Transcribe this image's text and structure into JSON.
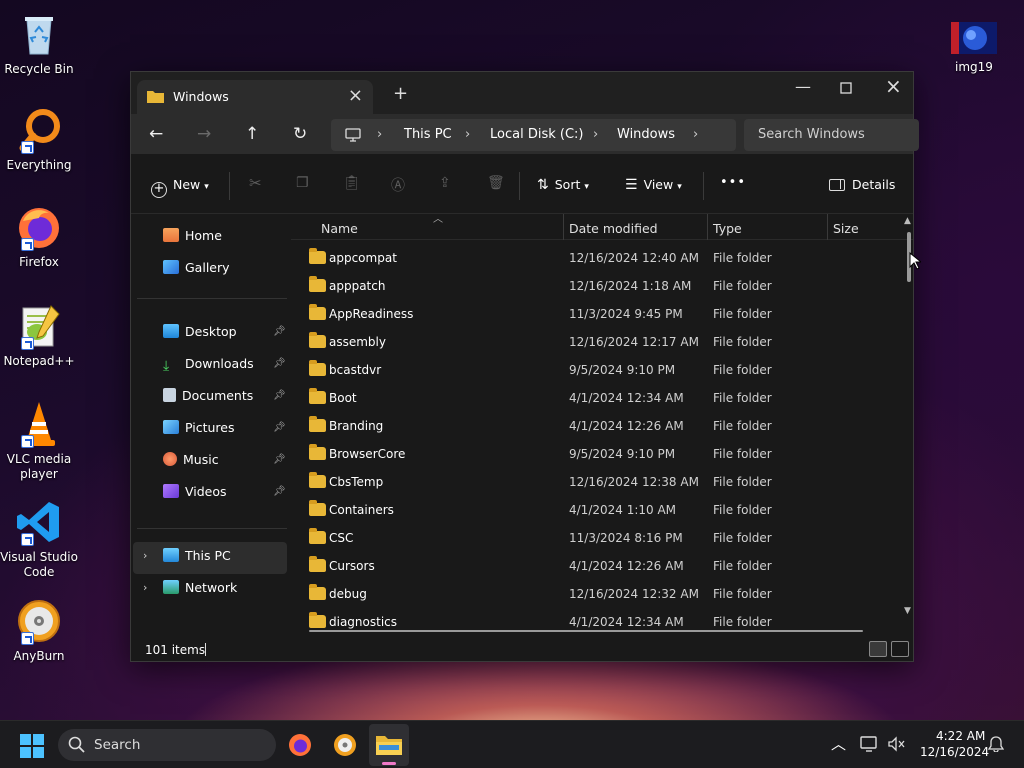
{
  "desktop": {
    "icons": [
      {
        "label": "Recycle Bin"
      },
      {
        "label": "Everything"
      },
      {
        "label": "Firefox"
      },
      {
        "label": "Notepad++"
      },
      {
        "label": "VLC media player"
      },
      {
        "label": "Visual Studio Code"
      },
      {
        "label": "AnyBurn"
      },
      {
        "label": "img19"
      }
    ]
  },
  "window": {
    "tab_title": "Windows",
    "address": [
      "This PC",
      "Local Disk (C:)",
      "Windows"
    ],
    "search_placeholder": "Search Windows",
    "toolbar": {
      "new": "New",
      "sort": "Sort",
      "view": "View",
      "more": "•••",
      "details": "Details"
    },
    "sidebar": {
      "home": "Home",
      "gallery": "Gallery",
      "desktop": "Desktop",
      "downloads": "Downloads",
      "documents": "Documents",
      "pictures": "Pictures",
      "music": "Music",
      "videos": "Videos",
      "this_pc": "This PC",
      "network": "Network"
    },
    "columns": {
      "name": "Name",
      "date": "Date modified",
      "type": "Type",
      "size": "Size"
    },
    "rows": [
      {
        "name": "appcompat",
        "date": "12/16/2024 12:40 AM",
        "type": "File folder"
      },
      {
        "name": "apppatch",
        "date": "12/16/2024 1:18 AM",
        "type": "File folder"
      },
      {
        "name": "AppReadiness",
        "date": "11/3/2024 9:45 PM",
        "type": "File folder"
      },
      {
        "name": "assembly",
        "date": "12/16/2024 12:17 AM",
        "type": "File folder"
      },
      {
        "name": "bcastdvr",
        "date": "9/5/2024 9:10 PM",
        "type": "File folder"
      },
      {
        "name": "Boot",
        "date": "4/1/2024 12:34 AM",
        "type": "File folder"
      },
      {
        "name": "Branding",
        "date": "4/1/2024 12:26 AM",
        "type": "File folder"
      },
      {
        "name": "BrowserCore",
        "date": "9/5/2024 9:10 PM",
        "type": "File folder"
      },
      {
        "name": "CbsTemp",
        "date": "12/16/2024 12:38 AM",
        "type": "File folder"
      },
      {
        "name": "Containers",
        "date": "4/1/2024 1:10 AM",
        "type": "File folder"
      },
      {
        "name": "CSC",
        "date": "11/3/2024 8:16 PM",
        "type": "File folder"
      },
      {
        "name": "Cursors",
        "date": "4/1/2024 12:26 AM",
        "type": "File folder"
      },
      {
        "name": "debug",
        "date": "12/16/2024 12:32 AM",
        "type": "File folder"
      },
      {
        "name": "diagnostics",
        "date": "4/1/2024 12:34 AM",
        "type": "File folder"
      }
    ],
    "status": "101 items"
  },
  "taskbar": {
    "search": "Search",
    "time": "4:22 AM",
    "date": "12/16/2024"
  },
  "colors": {
    "folder": "#e8b737",
    "accent": "#4cc2ff"
  }
}
